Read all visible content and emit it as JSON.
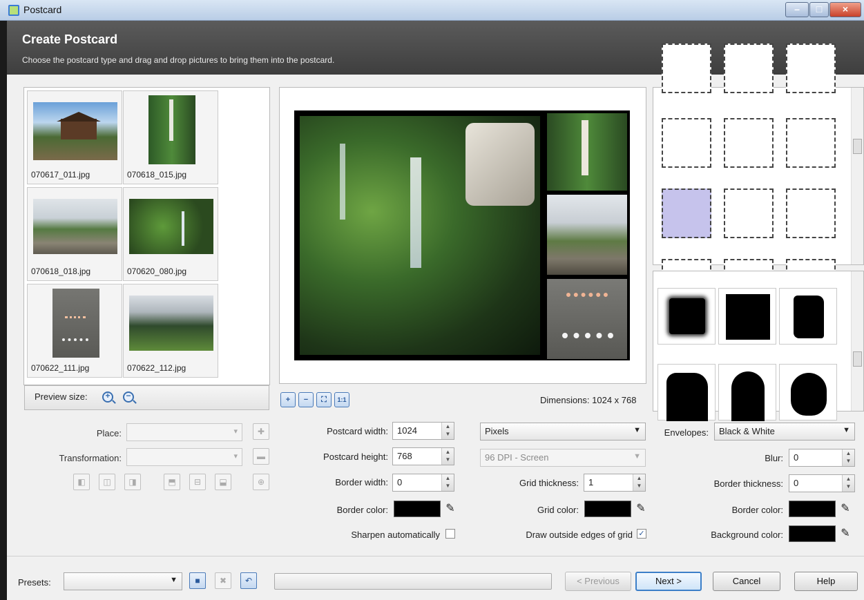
{
  "window": {
    "title": "Postcard"
  },
  "header": {
    "title": "Create Postcard",
    "subtitle": "Choose the postcard type and drag and drop pictures to bring them into the postcard."
  },
  "thumbnails": [
    {
      "name": "070617_011.jpg"
    },
    {
      "name": "070618_015.jpg"
    },
    {
      "name": "070618_018.jpg"
    },
    {
      "name": "070620_080.jpg"
    },
    {
      "name": "070622_111.jpg"
    },
    {
      "name": "070622_112.jpg"
    }
  ],
  "preview": {
    "label": "Preview size:",
    "zoom_in": "+",
    "zoom_out": "−"
  },
  "canvas_tools": {
    "zoom_in": "+",
    "zoom_out": "−",
    "fit": "⛶",
    "actual": "1:1"
  },
  "dimensions_text": "Dimensions: 1024 x 768",
  "place": {
    "label": "Place:",
    "value": ""
  },
  "transformation": {
    "label": "Transformation:",
    "value": ""
  },
  "postcard": {
    "width_label": "Postcard width:",
    "width": "1024",
    "height_label": "Postcard height:",
    "height": "768",
    "border_width_label": "Border width:",
    "border_width": "0",
    "border_color_label": "Border color:",
    "sharpen_label": "Sharpen automatically",
    "sharpen_checked": false
  },
  "units": {
    "value": "Pixels",
    "dpi": "96 DPI - Screen"
  },
  "grid": {
    "thickness_label": "Grid thickness:",
    "thickness": "1",
    "color_label": "Grid color:",
    "outside_label": "Draw outside edges of grid",
    "outside_checked": true
  },
  "envelopes": {
    "label": "Envelopes:",
    "value": "Black & White",
    "blur_label": "Blur:",
    "blur": "0",
    "border_thickness_label": "Border thickness:",
    "border_thickness": "0",
    "border_color_label": "Border color:",
    "background_color_label": "Background color:"
  },
  "colors": {
    "swatch": "#000000",
    "selected_frame": "#c6c3ec",
    "primary_border": "#3c7fc8"
  },
  "footer": {
    "presets_label": "Presets:",
    "presets_value": "",
    "previous": "< Previous",
    "next": "Next >",
    "cancel": "Cancel",
    "help": "Help"
  }
}
